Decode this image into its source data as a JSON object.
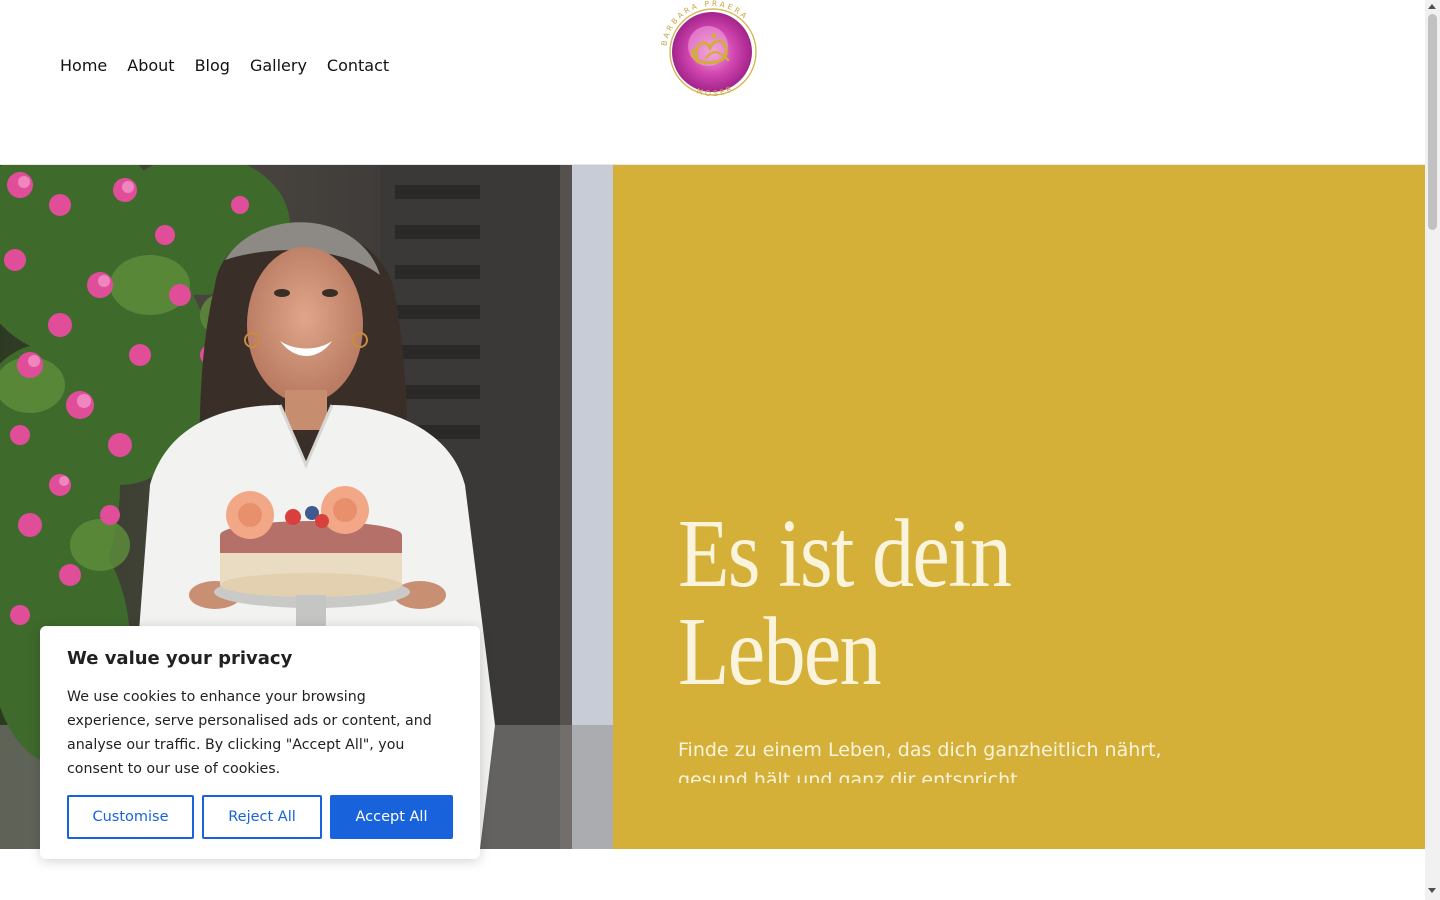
{
  "nav": {
    "items": [
      {
        "label": "Home"
      },
      {
        "label": "About"
      },
      {
        "label": "Blog"
      },
      {
        "label": "Gallery"
      },
      {
        "label": "Contact"
      }
    ]
  },
  "logo": {
    "top_text": "BARBARA PRAERA",
    "bottom_text": "MOSER"
  },
  "hero": {
    "title_line1": "Es ist dein",
    "title_line2": "Leben",
    "subtitle": "Finde zu einem Leben, das dich ganzheitlich nährt, gesund hält und ganz dir entspricht.",
    "panel_color": "#d4b038",
    "text_color": "#fbf4dc"
  },
  "cookie": {
    "title": "We value your privacy",
    "body": "We use cookies to enhance your browsing experience, serve personalised ads or content, and analyse our traffic. By clicking \"Accept All\", you consent to our use of cookies.",
    "customise_label": "Customise",
    "reject_label": "Reject All",
    "accept_label": "Accept All",
    "accent_color": "#1863dc"
  }
}
